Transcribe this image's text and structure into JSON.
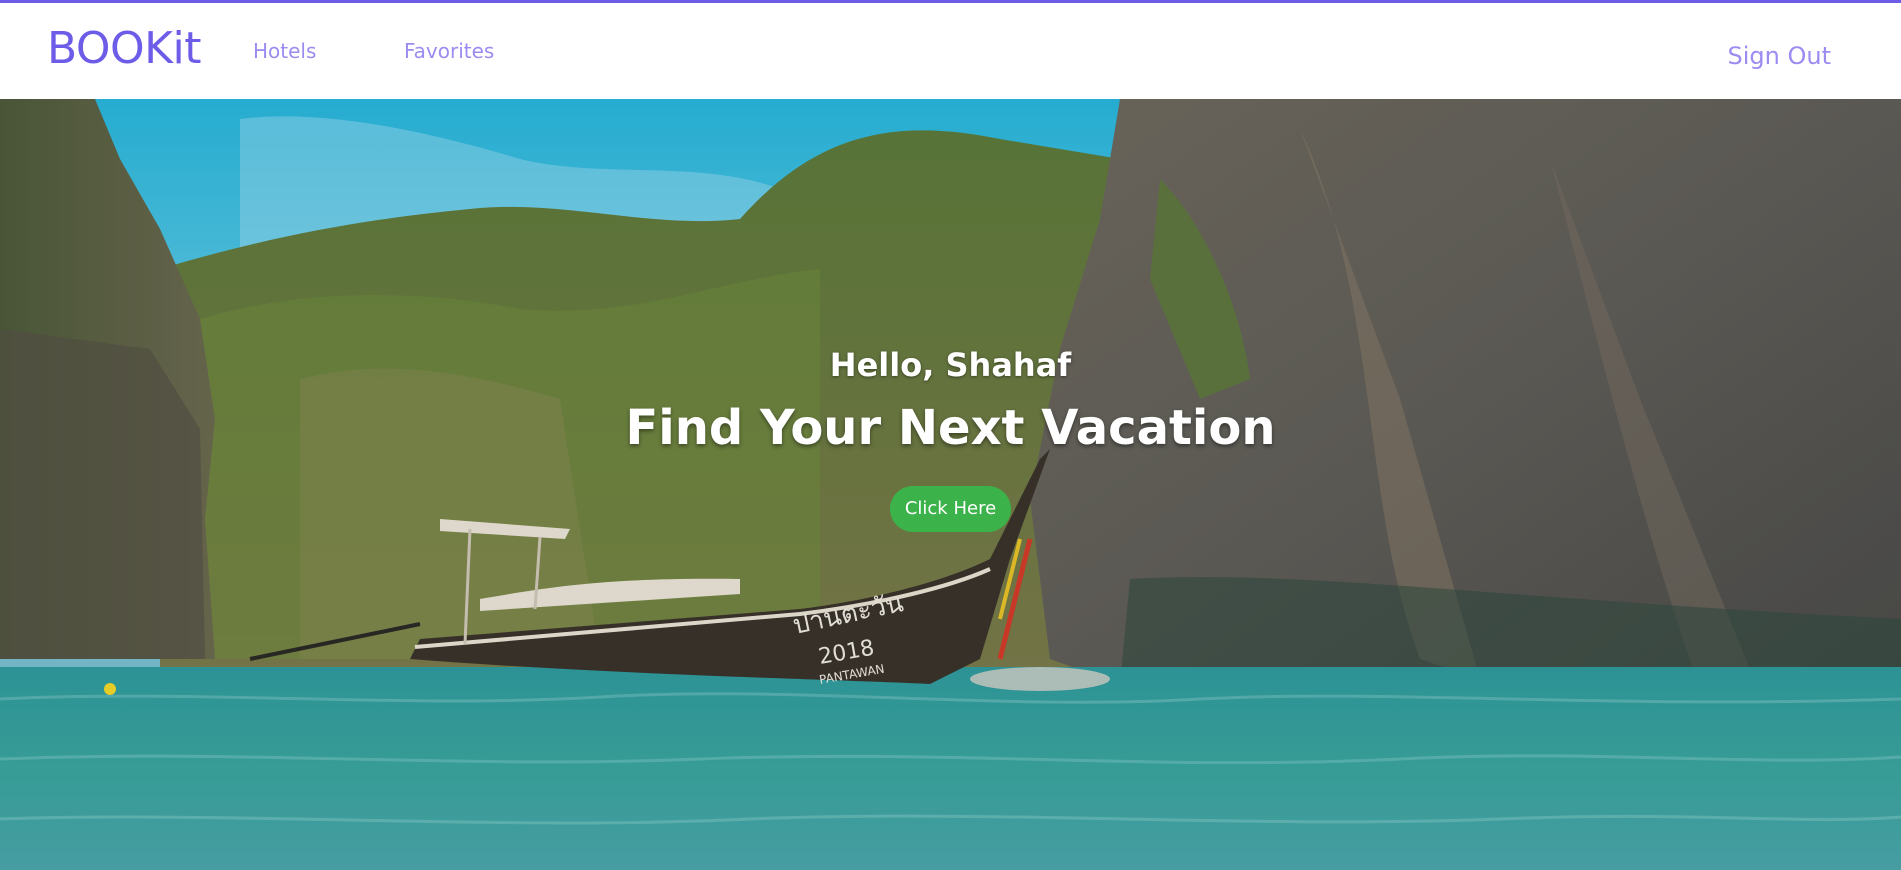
{
  "navbar": {
    "brand": "BOOKit",
    "links": [
      {
        "label": "Hotels"
      },
      {
        "label": "Favorites"
      }
    ],
    "sign_out": "Sign Out"
  },
  "hero": {
    "greeting": "Hello, Shahaf",
    "headline": "Find Your Next Vacation",
    "cta_label": "Click Here",
    "boat": {
      "hull_text": "ปานตะวัน",
      "year": "2018",
      "name": "PANTAWAN"
    }
  },
  "colors": {
    "accent": "#6c5ce7",
    "nav_link": "#9a8cf0",
    "cta": "#3cb34a",
    "sky": "#36c0e0",
    "water": "#3b9a98"
  }
}
